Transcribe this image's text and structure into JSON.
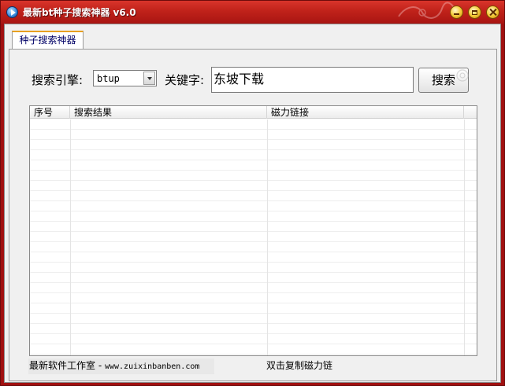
{
  "window": {
    "title": "最新bt种子搜索神器 v6.0",
    "title_color": "#ffffff",
    "titlebar_color": "#c0221a"
  },
  "tabs": [
    {
      "label": "种子搜索神器",
      "active": true
    }
  ],
  "search": {
    "engine_label": "搜索引擎:",
    "engine_value": "btup",
    "keyword_label": "关键字:",
    "keyword_value": "东坡下载",
    "button_label": "搜索"
  },
  "results_table": {
    "columns": [
      "序号",
      "搜索结果",
      "磁力链接"
    ],
    "rows": []
  },
  "status": {
    "left_text": "最新软件工作室 - ",
    "left_url": "www.zuixinbanben.com",
    "right_text": "双击复制磁力链"
  },
  "icons": {
    "app": "app-logo-icon",
    "minimize": "minimize-icon",
    "maximize": "maximize-icon",
    "close": "close-icon",
    "dropdown": "chevron-down-icon"
  }
}
